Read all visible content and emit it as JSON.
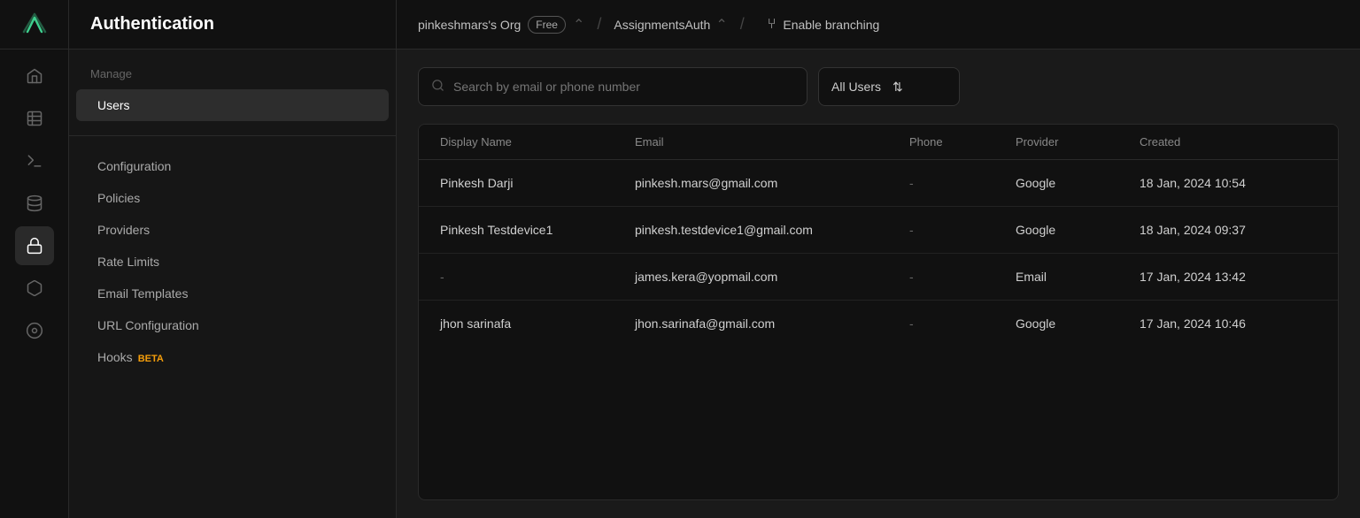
{
  "header": {
    "app_title": "Authentication",
    "org_name": "pinkeshmars's Org",
    "free_label": "Free",
    "separator": "/",
    "project_name": "AssignmentsAuth",
    "enable_branching_label": "Enable branching"
  },
  "sidebar_icons": [
    {
      "name": "home-icon",
      "glyph": "⌂"
    },
    {
      "name": "table-icon",
      "glyph": "⊞"
    },
    {
      "name": "terminal-icon",
      "glyph": ">_"
    },
    {
      "name": "database-icon",
      "glyph": "◫"
    },
    {
      "name": "lock-icon",
      "glyph": "🔒"
    },
    {
      "name": "storage-icon",
      "glyph": "⬡"
    },
    {
      "name": "monitoring-icon",
      "glyph": "◉"
    }
  ],
  "sidebar": {
    "manage_label": "Manage",
    "users_label": "Users",
    "configuration_label": "Configuration",
    "policies_label": "Policies",
    "providers_label": "Providers",
    "rate_limits_label": "Rate Limits",
    "email_templates_label": "Email Templates",
    "url_configuration_label": "URL Configuration",
    "hooks_label": "Hooks",
    "beta_label": "BETA"
  },
  "search": {
    "placeholder": "Search by email or phone number",
    "filter_label": "All Users"
  },
  "table": {
    "columns": [
      {
        "label": "Display Name"
      },
      {
        "label": "Email"
      },
      {
        "label": "Phone"
      },
      {
        "label": "Provider"
      },
      {
        "label": "Created"
      }
    ],
    "rows": [
      {
        "display_name": "Pinkesh Darji",
        "email": "pinkesh.mars@gmail.com",
        "phone": "-",
        "provider": "Google",
        "created": "18 Jan, 2024 10:54"
      },
      {
        "display_name": "Pinkesh Testdevice1",
        "email": "pinkesh.testdevice1@gmail.com",
        "phone": "-",
        "provider": "Google",
        "created": "18 Jan, 2024 09:37"
      },
      {
        "display_name": "-",
        "email": "james.kera@yopmail.com",
        "phone": "-",
        "provider": "Email",
        "created": "17 Jan, 2024 13:42"
      },
      {
        "display_name": "jhon sarinafa",
        "email": "jhon.sarinafa@gmail.com",
        "phone": "-",
        "provider": "Google",
        "created": "17 Jan, 2024 10:46"
      }
    ]
  },
  "colors": {
    "accent": "#3ecf8e",
    "brand": "#00d084",
    "beta": "#f59e0b"
  }
}
